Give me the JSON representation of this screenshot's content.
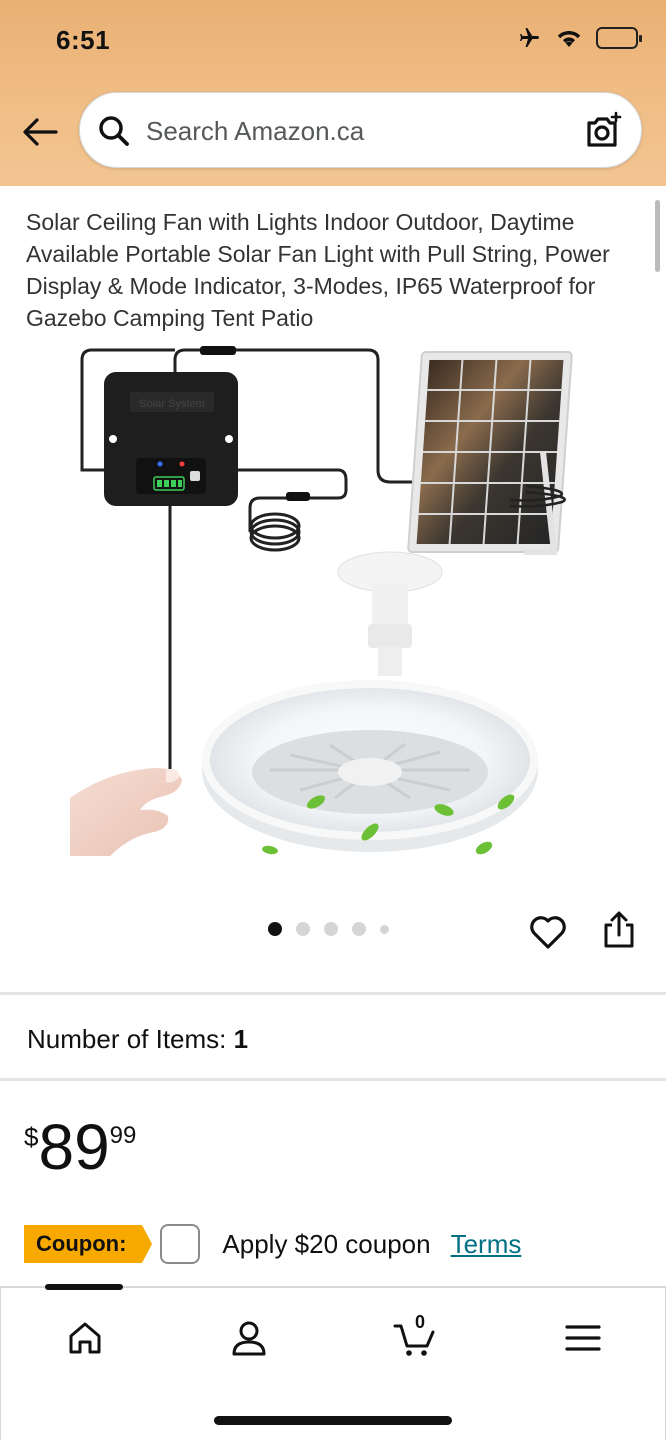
{
  "status_bar": {
    "time": "6:51"
  },
  "search": {
    "placeholder": "Search Amazon.ca"
  },
  "product": {
    "title": "Solar Ceiling Fan with Lights Indoor Outdoor, Daytime Available Portable Solar Fan Light with Pull String, Power Display & Mode Indicator, 3-Modes, IP65 Waterproof for Gazebo Camping Tent Patio",
    "image_count": 5,
    "active_image": 1
  },
  "quantity": {
    "label": "Number of Items:",
    "value": "1"
  },
  "price": {
    "currency": "$",
    "whole": "89",
    "fraction": "99"
  },
  "coupon": {
    "badge": "Coupon:",
    "text": "Apply $20 coupon",
    "terms": "Terms"
  },
  "nav": {
    "cart_count": "0"
  },
  "colors": {
    "header": "#f0bd86",
    "coupon": "#f7a900",
    "link": "#007185"
  },
  "icons": [
    "airplane-icon",
    "wifi-icon",
    "battery-icon",
    "back-arrow-icon",
    "search-icon",
    "camera-icon",
    "heart-icon",
    "share-icon",
    "home-icon",
    "account-icon",
    "cart-icon",
    "menu-icon"
  ]
}
